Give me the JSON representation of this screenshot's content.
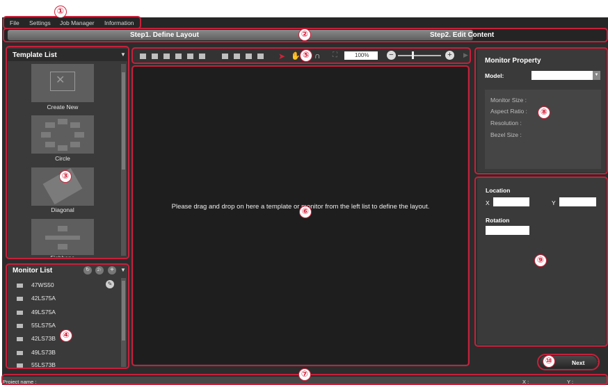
{
  "menu": [
    "File",
    "Settings",
    "Job Manager",
    "Information"
  ],
  "steps": {
    "step1": "Step1. Define Layout",
    "step2": "Step2. Edit Content"
  },
  "template_list": {
    "title": "Template List",
    "items": [
      {
        "label": "Create New"
      },
      {
        "label": "Circle"
      },
      {
        "label": "Diagonal"
      },
      {
        "label": "Fishbone"
      }
    ]
  },
  "monitor_list": {
    "title": "Monitor List",
    "items": [
      "47WS50",
      "42LS75A",
      "49LS75A",
      "55LS75A",
      "42LS73B",
      "49LS73B",
      "55LS73B"
    ]
  },
  "toolbar": {
    "zoom": "100%"
  },
  "canvas": {
    "hint": "Please drag and drop on here a template or monitor from the left list to define the layout."
  },
  "monitor_property": {
    "title": "Monitor Property",
    "model_label": "Model:",
    "fields": [
      "Monitor Size :",
      "Aspect Ratio :",
      "Resolution :",
      "Bezel Size :"
    ]
  },
  "position": {
    "location_label": "Location",
    "x_label": "X",
    "y_label": "Y",
    "rotation_label": "Rotation"
  },
  "next_button": "Next",
  "status": {
    "project_label": "Project name :",
    "x_label": "X :",
    "y_label": "Y :"
  },
  "callouts": [
    "①",
    "②",
    "③",
    "④",
    "⑤",
    "⑥",
    "⑦",
    "⑧",
    "⑨",
    "⑩"
  ],
  "colors": {
    "accent": "#c8203a",
    "panel": "#3a3a3a",
    "background": "#2c2c2c"
  }
}
